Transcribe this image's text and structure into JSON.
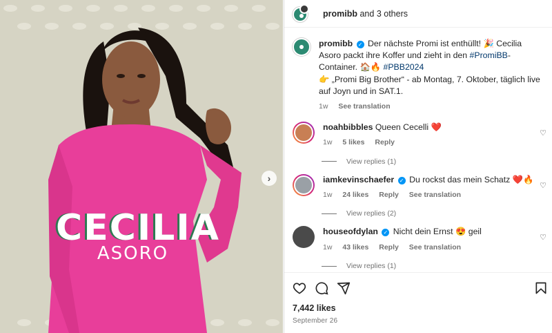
{
  "header": {
    "user": "promibb",
    "others_text": "and 3 others"
  },
  "media": {
    "title": "CECILIA",
    "subtitle": "ASORO",
    "next_label": "›"
  },
  "caption": {
    "username": "promibb",
    "text_1": "Der nächste Promi ist enthüllt! 🎉 Cecilia Asoro packt ihre Koffer und zieht in den ",
    "hashtag_1": "#PromiBB",
    "text_2": "-Container. 🏠🔥 ",
    "hashtag_2": "#PBB2024",
    "text_3": "👉 „Promi Big Brother“ - ab Montag, 7. Oktober, täglich live auf Joyn und in SAT.1.",
    "time": "1w",
    "translation": "See translation"
  },
  "comments": [
    {
      "username": "noahbibbles",
      "verified": false,
      "text": "Queen Cecelli ❤️",
      "time": "1w",
      "likes": "5 likes",
      "reply": "Reply",
      "translation": "",
      "replies": "View replies (1)"
    },
    {
      "username": "iamkevinschaefer",
      "verified": true,
      "text": "Du rockst das mein Schatz ❤️🔥",
      "time": "1w",
      "likes": "24 likes",
      "reply": "Reply",
      "translation": "See translation",
      "replies": "View replies (2)"
    },
    {
      "username": "houseofdylan",
      "verified": true,
      "text": "Nicht dein Ernst 😍 geil",
      "time": "1w",
      "likes": "43 likes",
      "reply": "Reply",
      "translation": "See translation",
      "replies": "View replies (1)"
    }
  ],
  "footer": {
    "likes": "7,442 likes",
    "date": "September 26"
  },
  "icons": [
    "heart-icon",
    "comment-icon",
    "share-icon",
    "bookmark-icon",
    "chevron-right-icon",
    "verified-icon"
  ],
  "colors": {
    "verified": "#0095f6",
    "hashtag": "#00376b",
    "accent_green": "#2c8a72",
    "dress_pink": "#e83e9a"
  }
}
